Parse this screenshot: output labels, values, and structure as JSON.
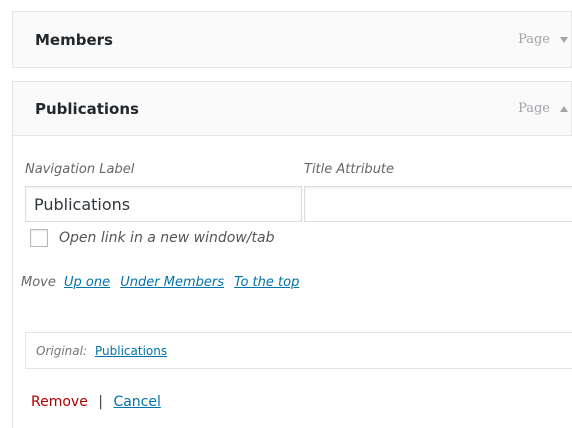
{
  "items": [
    {
      "title": "Members",
      "type": "Page",
      "expanded": false
    },
    {
      "title": "Publications",
      "type": "Page",
      "expanded": true
    }
  ],
  "settings": {
    "navigation_label": {
      "label": "Navigation Label",
      "value": "Publications"
    },
    "title_attribute": {
      "label": "Title Attribute",
      "value": ""
    },
    "new_window": {
      "label": "Open link in a new window/tab",
      "checked": false
    },
    "move": {
      "label": "Move",
      "links": [
        "Up one",
        "Under Members",
        "To the top"
      ]
    },
    "original": {
      "label": "Original:",
      "link": "Publications"
    },
    "actions": {
      "remove": "Remove",
      "separator": "|",
      "cancel": "Cancel"
    }
  },
  "colors": {
    "link": "#0073aa",
    "remove": "#aa0000",
    "border": "#e5e5e5"
  }
}
